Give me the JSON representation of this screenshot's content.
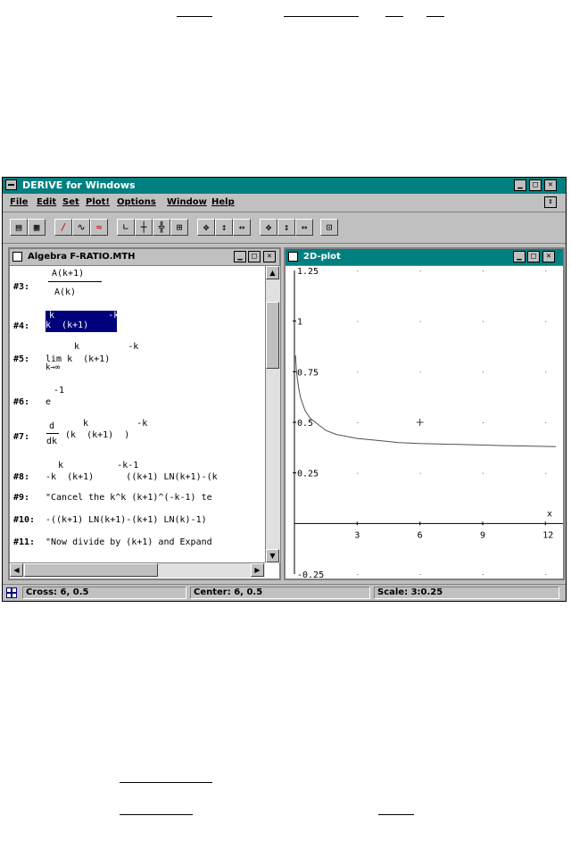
{
  "window": {
    "title": "DERIVE for Windows",
    "menus": [
      "File",
      "Edit",
      "Set",
      "Plot!",
      "Options",
      "Window",
      "Help"
    ]
  },
  "toolbar": {
    "icons": [
      "open-file-icon",
      "print-icon",
      "author-icon",
      "expand-icon",
      "simplify-icon",
      "axis-icon",
      "cross-icon",
      "center-icon",
      "grid-icon",
      "move-icon",
      "vscale-icon",
      "hscale-icon",
      "zoom-move-icon",
      "zoom-v-icon",
      "zoom-h-icon",
      "range-icon"
    ]
  },
  "algebra": {
    "title": "Algebra  F-RATIO.MTH",
    "lines": [
      {
        "label": "#3:",
        "num": "A(k+1)",
        "den": "A(k)"
      },
      {
        "label": "#4:",
        "sup": "k          -k",
        "main": "k  (k+1)"
      },
      {
        "label": "#5:",
        "sup": "k         -k",
        "main": "lim k  (k+1)",
        "sub": "k→∞"
      },
      {
        "label": "#6:",
        "sup": "-1",
        "main": "e"
      },
      {
        "label": "#7:",
        "num": "d",
        "den": "dk",
        "sup": "k         -k",
        "main": "(k  (k+1)  )"
      },
      {
        "label": "#8:",
        "sup": "k          -k-1",
        "main": "-k  (k+1)      ((k+1) LN(k+1)-(k"
      },
      {
        "label": "#9:",
        "main": "\"Cancel the k^k (k+1)^(-k-1) te"
      },
      {
        "label": "#10:",
        "main": "-((k+1) LN(k+1)-(k+1) LN(k)-1)"
      },
      {
        "label": "#11:",
        "main": "\"Now divide by (k+1) and Expand"
      }
    ]
  },
  "plot": {
    "title": "2D-plot",
    "x_axis_label": "x",
    "y_ticks": [
      "1.25",
      "1",
      "0.75",
      "0.5",
      "0.25",
      "-0.25"
    ],
    "x_ticks": [
      "3",
      "6",
      "9",
      "12"
    ],
    "cross": {
      "x": 6,
      "y": 0.5
    }
  },
  "chart_data": {
    "type": "line",
    "title": "",
    "xlabel": "x",
    "ylabel": "",
    "xlim": [
      0,
      12.5
    ],
    "ylim": [
      -0.25,
      1.25
    ],
    "grid": "dots",
    "series": [
      {
        "x": [
          0.05,
          0.1,
          0.2,
          0.3,
          0.5,
          0.75,
          1,
          1.5,
          2,
          3,
          4,
          5,
          6,
          8,
          10,
          12.5
        ],
        "values": [
          0.83,
          0.75,
          0.67,
          0.62,
          0.56,
          0.52,
          0.5,
          0.46,
          0.44,
          0.42,
          0.41,
          0.4,
          0.395,
          0.39,
          0.385,
          0.38
        ]
      }
    ]
  },
  "status": {
    "cross": "Cross: 6, 0.5",
    "center": "Center: 6, 0.5",
    "scale": "Scale: 3:0.25"
  }
}
